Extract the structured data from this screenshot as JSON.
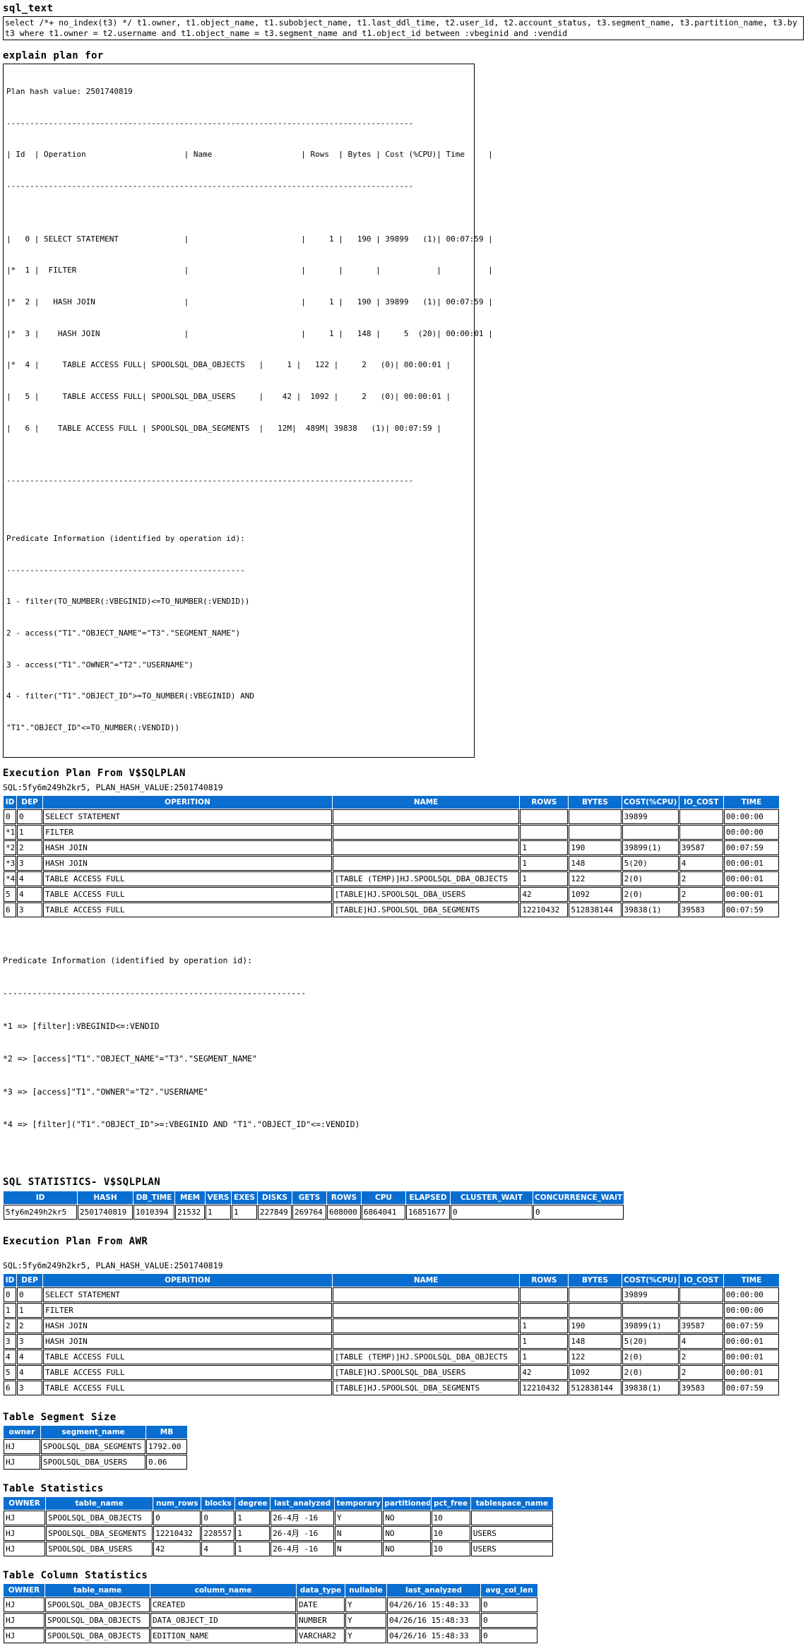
{
  "sql_text": {
    "title": "sql_text",
    "line1": "select /*+ no_index(t3) */ t1.owner, t1.object_name, t1.subobject_name, t1.last_ddl_time, t2.user_id, t2.account_status, t3.segment_name, t3.partition_name, t3.by",
    "line2": "t3 where t1.owner = t2.username and t1.object_name = t3.segment_name and t1.object_id between :vbeginid and :vendid"
  },
  "explain_plan": {
    "title": "explain plan for",
    "plan_hash_line": "Plan hash value: 2501740819",
    "divider": "---------------------------------------------------------------------------------------",
    "header": "| Id  | Operation                     | Name                   | Rows  | Bytes | Cost (%CPU)| Time     |",
    "rows": [
      "|   0 | SELECT STATEMENT              |                        |     1 |   190 | 39899   (1)| 00:07:59 |",
      "|*  1 |  FILTER                       |                        |       |       |            |          |",
      "|*  2 |   HASH JOIN                   |                        |     1 |   190 | 39899   (1)| 00:07:59 |",
      "|*  3 |    HASH JOIN                  |                        |     1 |   148 |     5  (20)| 00:00:01 |",
      "|*  4 |     TABLE ACCESS FULL| SPOOLSQL_DBA_OBJECTS   |     1 |   122 |     2   (0)| 00:00:01 |",
      "|   5 |     TABLE ACCESS FULL| SPOOLSQL_DBA_USERS     |    42 |  1092 |     2   (0)| 00:00:01 |",
      "|   6 |    TABLE ACCESS FULL | SPOOLSQL_DBA_SEGMENTS  |   12M|  489M| 39838   (1)| 00:07:59 |"
    ],
    "predicate_title": "Predicate Information (identified by operation id):",
    "predicate_divider": "---------------------------------------------------",
    "predicates": [
      "1 - filter(TO_NUMBER(:VBEGINID)<=TO_NUMBER(:VENDID))",
      "2 - access(\"T1\".\"OBJECT_NAME\"=\"T3\".\"SEGMENT_NAME\")",
      "3 - access(\"T1\".\"OWNER\"=\"T2\".\"USERNAME\")",
      "4 - filter(\"T1\".\"OBJECT_ID\">=TO_NUMBER(:VBEGINID) AND",
      "\"T1\".\"OBJECT_ID\"<=TO_NUMBER(:VENDID))"
    ]
  },
  "vsqlplan": {
    "title": "Execution Plan From V$SQLPLAN",
    "sql_line": "SQL:5fy6m249h2kr5, PLAN_HASH_VALUE:2501740819",
    "columns": [
      "ID",
      "DEP",
      "OPERITION",
      "NAME",
      "ROWS",
      "BYTES",
      "COST(%CPU)",
      "IO_COST",
      "TIME"
    ],
    "rows": [
      {
        "id": "0",
        "dep": "0",
        "operation": "SELECT STATEMENT",
        "indent": 0,
        "name": "",
        "rows": "",
        "bytes": "",
        "cost": "39899",
        "io_cost": "",
        "time": "00:00:00"
      },
      {
        "id": "*1",
        "dep": "1",
        "operation": "FILTER",
        "indent": 1,
        "name": "",
        "rows": "",
        "bytes": "",
        "cost": "",
        "io_cost": "",
        "time": "00:00:00"
      },
      {
        "id": "*2",
        "dep": "2",
        "operation": "HASH JOIN",
        "indent": 2,
        "name": "",
        "rows": "1",
        "bytes": "190",
        "cost": "39899(1)",
        "io_cost": "39587",
        "time": "00:07:59"
      },
      {
        "id": "*3",
        "dep": "3",
        "operation": "HASH JOIN",
        "indent": 3,
        "name": "",
        "rows": "1",
        "bytes": "148",
        "cost": "5(20)",
        "io_cost": "4",
        "time": "00:00:01"
      },
      {
        "id": "*4",
        "dep": "4",
        "operation": "TABLE ACCESS FULL",
        "indent": 4,
        "name": "[TABLE (TEMP)]HJ.SPOOLSQL_DBA_OBJECTS",
        "rows": "1",
        "bytes": "122",
        "cost": "2(0)",
        "io_cost": "2",
        "time": "00:00:01"
      },
      {
        "id": "5",
        "dep": "4",
        "operation": "TABLE ACCESS FULL",
        "indent": 4,
        "name": "[TABLE]HJ.SPOOLSQL_DBA_USERS",
        "rows": "42",
        "bytes": "1092",
        "cost": "2(0)",
        "io_cost": "2",
        "time": "00:00:01"
      },
      {
        "id": "6",
        "dep": "3",
        "operation": "TABLE ACCESS FULL",
        "indent": 3,
        "name": "[TABLE]HJ.SPOOLSQL_DBA_SEGMENTS",
        "rows": "12210432",
        "bytes": "512838144",
        "cost": "39838(1)",
        "io_cost": "39583",
        "time": "00:07:59"
      }
    ],
    "predicate_title": "Predicate Information (identified by operation id):",
    "predicate_divider": "--------------------------------------------------------------",
    "predicates": [
      "*1 => [filter]:VBEGINID<=:VENDID",
      "*2 => [access]\"T1\".\"OBJECT_NAME\"=\"T3\".\"SEGMENT_NAME\"",
      "*3 => [access]\"T1\".\"OWNER\"=\"T2\".\"USERNAME\"",
      "*4 => [filter](\"T1\".\"OBJECT_ID\">=:VBEGINID AND \"T1\".\"OBJECT_ID\"<=:VENDID)"
    ]
  },
  "sql_statistics": {
    "title": "SQL STATISTICS- V$SQLPLAN",
    "columns": [
      "ID",
      "HASH",
      "DB_TIME",
      "MEM",
      "VERS",
      "EXES",
      "DISKS",
      "GETS",
      "ROWS",
      "CPU",
      "ELAPSED",
      "CLUSTER_WAIT",
      "CONCURRENCE_WAIT"
    ],
    "rows": [
      [
        "5fy6m249h2kr5",
        "2501740819",
        "1010394",
        "21532",
        "1",
        "1",
        "227849",
        "269764",
        "608000",
        "6864041",
        "16851677",
        "0",
        "0"
      ]
    ]
  },
  "awr_plan": {
    "title": "Execution Plan From AWR",
    "sql_line": "SQL:5fy6m249h2kr5, PLAN_HASH_VALUE:2501740819",
    "columns": [
      "ID",
      "DEP",
      "OPERITION",
      "NAME",
      "ROWS",
      "BYTES",
      "COST(%CPU)",
      "IO_COST",
      "TIME"
    ],
    "rows": [
      {
        "id": "0",
        "dep": "0",
        "operation": "SELECT STATEMENT",
        "indent": 0,
        "name": "",
        "rows": "",
        "bytes": "",
        "cost": "39899",
        "io_cost": "",
        "time": "00:00:00"
      },
      {
        "id": "1",
        "dep": "1",
        "operation": "FILTER",
        "indent": 1,
        "name": "",
        "rows": "",
        "bytes": "",
        "cost": "",
        "io_cost": "",
        "time": "00:00:00"
      },
      {
        "id": "2",
        "dep": "2",
        "operation": "HASH JOIN",
        "indent": 2,
        "name": "",
        "rows": "1",
        "bytes": "190",
        "cost": "39899(1)",
        "io_cost": "39587",
        "time": "00:07:59"
      },
      {
        "id": "3",
        "dep": "3",
        "operation": "HASH JOIN",
        "indent": 3,
        "name": "",
        "rows": "1",
        "bytes": "148",
        "cost": "5(20)",
        "io_cost": "4",
        "time": "00:00:01"
      },
      {
        "id": "4",
        "dep": "4",
        "operation": "TABLE ACCESS FULL",
        "indent": 4,
        "name": "[TABLE (TEMP)]HJ.SPOOLSQL_DBA_OBJECTS",
        "rows": "1",
        "bytes": "122",
        "cost": "2(0)",
        "io_cost": "2",
        "time": "00:00:01"
      },
      {
        "id": "5",
        "dep": "4",
        "operation": "TABLE ACCESS FULL",
        "indent": 4,
        "name": "[TABLE]HJ.SPOOLSQL_DBA_USERS",
        "rows": "42",
        "bytes": "1092",
        "cost": "2(0)",
        "io_cost": "2",
        "time": "00:00:01"
      },
      {
        "id": "6",
        "dep": "3",
        "operation": "TABLE ACCESS FULL",
        "indent": 3,
        "name": "[TABLE]HJ.SPOOLSQL_DBA_SEGMENTS",
        "rows": "12210432",
        "bytes": "512838144",
        "cost": "39838(1)",
        "io_cost": "39583",
        "time": "00:07:59"
      }
    ]
  },
  "table_segment_size": {
    "title": "Table Segment Size",
    "columns": [
      "owner",
      "segment_name",
      "MB"
    ],
    "rows": [
      [
        "HJ",
        "SPOOLSQL_DBA_SEGMENTS",
        "1792.00"
      ],
      [
        "HJ",
        "SPOOLSQL_DBA_USERS",
        "0.06"
      ]
    ]
  },
  "table_statistics": {
    "title": "Table Statistics",
    "columns": [
      "OWNER",
      "table_name",
      "num_rows",
      "blocks",
      "degree",
      "last_analyzed",
      "temporary",
      "partitioned",
      "pct_free",
      "tablespace_name"
    ],
    "rows": [
      [
        "HJ",
        "SPOOLSQL_DBA_OBJECTS",
        "0",
        "0",
        "1",
        "26-4月 -16",
        "Y",
        "NO",
        "10",
        ""
      ],
      [
        "HJ",
        "SPOOLSQL_DBA_SEGMENTS",
        "12210432",
        "228557",
        "1",
        "26-4月 -16",
        "N",
        "NO",
        "10",
        "USERS"
      ],
      [
        "HJ",
        "SPOOLSQL_DBA_USERS",
        "42",
        "4",
        "1",
        "26-4月 -16",
        "N",
        "NO",
        "10",
        "USERS"
      ]
    ]
  },
  "table_column_statistics": {
    "title": "Table Column Statistics",
    "columns": [
      "OWNER",
      "table_name",
      "column_name",
      "data_type",
      "nullable",
      "last_analyzed",
      "avg_col_len"
    ],
    "rows": [
      [
        "HJ",
        "SPOOLSQL_DBA_OBJECTS",
        "CREATED",
        "DATE",
        "Y",
        "04/26/16 15:48:33",
        "0"
      ],
      [
        "HJ",
        "SPOOLSQL_DBA_OBJECTS",
        "DATA_OBJECT_ID",
        "NUMBER",
        "Y",
        "04/26/16 15:48:33",
        "0"
      ],
      [
        "HJ",
        "SPOOLSQL_DBA_OBJECTS",
        "EDITION_NAME",
        "VARCHAR2",
        "Y",
        "04/26/16 15:48:33",
        "0"
      ]
    ]
  },
  "colors": {
    "header_blue": "#0a6ed1",
    "header_text": "#ffffff",
    "border": "#000000",
    "background": "#ffffff"
  }
}
